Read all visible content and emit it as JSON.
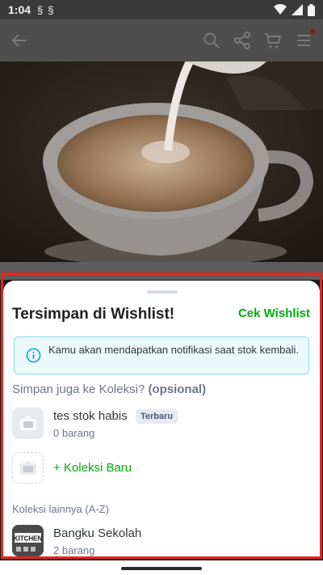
{
  "status_bar": {
    "time": "1:04",
    "sym1": "§",
    "sym2": "§"
  },
  "app_bar": {
    "icons": [
      "back-arrow-icon",
      "search-icon",
      "share-icon",
      "cart-icon",
      "menu-icon"
    ]
  },
  "colors": {
    "accent": "#03ac0e",
    "info_bg": "#ebf9fd",
    "info_border": "#89d9f2",
    "highlight": "#e8251c"
  },
  "sheet": {
    "title": "Tersimpan di Wishlist!",
    "action_label": "Cek Wishlist",
    "info_text": "Kamu akan mendapatkan notifikasi saat stok kembali.",
    "subtitle": "Simpan juga ke Koleksi?",
    "subtitle_bold": "(opsional)",
    "collections": [
      {
        "name": "tes stok habis",
        "count": "0 barang",
        "badge": "Terbaru"
      }
    ],
    "new_collection_label": "+ Koleksi Baru",
    "others_label": "Koleksi lainnya (A-Z)",
    "other_collections": [
      {
        "name": "Bangku Sekolah",
        "count": "2 barang",
        "thumb_text": "KITCHEN"
      }
    ]
  }
}
